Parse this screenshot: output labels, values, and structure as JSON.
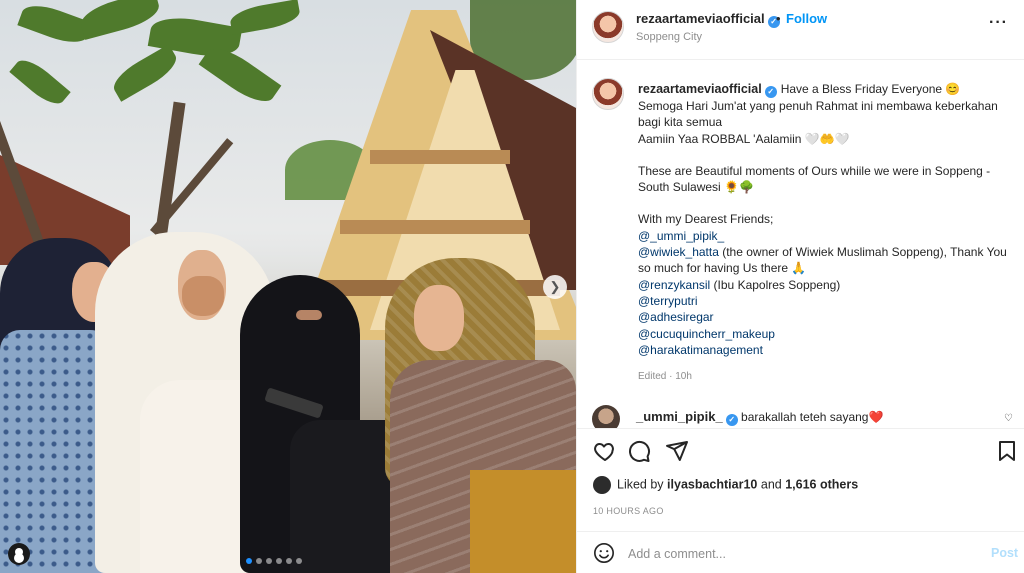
{
  "header": {
    "username": "rezaartameviaofficial",
    "dot": "•",
    "follow_label": "Follow",
    "location": "Soppeng City",
    "more_label": "···"
  },
  "caption": {
    "username": "rezaartameviaofficial",
    "lines": [
      "Have a Bless Friday Everyone 😊",
      "Semoga Hari Jum'at yang penuh Rahmat ini membawa keberkahan bagi kita semua",
      "Aamiin Yaa ROBBAL 'Aalamiin 🤍🤲🤍",
      "",
      "These are Beautiful moments of Ours whiile we were in Soppeng - South Sulawesi 🌻🌳",
      "",
      "With my Dearest Friends;"
    ],
    "mentions": [
      {
        "handle": "@_ummi_pipik_",
        "text": ""
      },
      {
        "handle": "@wiwiek_hatta",
        "text": " (the owner of Wiwiek Muslimah Soppeng), Thank You so much for having Us there 🙏"
      },
      {
        "handle": "@renzykansil",
        "text": " (Ibu Kapolres Soppeng)"
      },
      {
        "handle": "@terryputri",
        "text": ""
      },
      {
        "handle": "@adhesiregar",
        "text": ""
      },
      {
        "handle": "@cucuquincherr_makeup",
        "text": ""
      },
      {
        "handle": "@harakatimanagement",
        "text": ""
      }
    ],
    "edited": "Edited · 10h"
  },
  "comment": {
    "username": "_ummi_pipik_",
    "text": "barakallah teteh sayang❤️"
  },
  "likes": {
    "prefix": "Liked by",
    "user": "ilyasbachtiar10",
    "and": "and",
    "others": "1,616 others"
  },
  "time": "10 HOURS AGO",
  "add_comment": {
    "placeholder": "Add a comment...",
    "post_label": "Post"
  },
  "carousel": {
    "total": 6,
    "active": 1,
    "next_icon": "chevron-right-icon"
  },
  "colors": {
    "accent": "#0095f6",
    "verified": "#3897f0",
    "mention": "#00376b",
    "post_disabled": "#b2dffc",
    "muted": "#8e8e8e"
  }
}
